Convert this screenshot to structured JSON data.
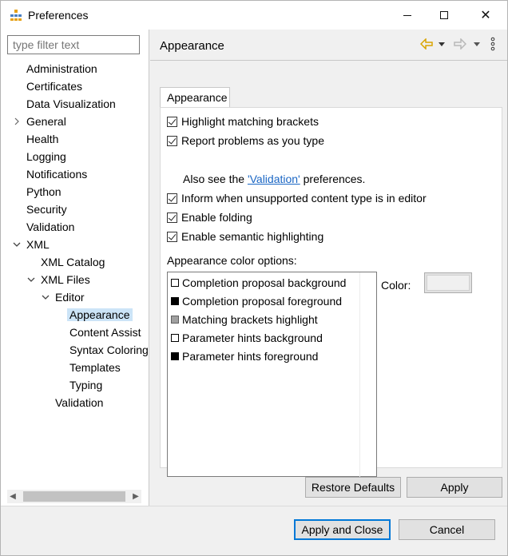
{
  "window": {
    "title": "Preferences",
    "minimize_icon": "minimize-icon",
    "maximize_icon": "maximize-icon",
    "close_glyph": "✕"
  },
  "filter": {
    "placeholder": "type filter text"
  },
  "tree": [
    {
      "label": "Administration",
      "indent": 0,
      "arrow": ""
    },
    {
      "label": "Certificates",
      "indent": 0,
      "arrow": ""
    },
    {
      "label": "Data Visualization",
      "indent": 0,
      "arrow": ""
    },
    {
      "label": "General",
      "indent": 0,
      "arrow": "›"
    },
    {
      "label": "Health",
      "indent": 0,
      "arrow": ""
    },
    {
      "label": "Logging",
      "indent": 0,
      "arrow": ""
    },
    {
      "label": "Notifications",
      "indent": 0,
      "arrow": ""
    },
    {
      "label": "Python",
      "indent": 0,
      "arrow": ""
    },
    {
      "label": "Security",
      "indent": 0,
      "arrow": ""
    },
    {
      "label": "Validation",
      "indent": 0,
      "arrow": ""
    },
    {
      "label": "XML",
      "indent": 0,
      "arrow": "⌄"
    },
    {
      "label": "XML Catalog",
      "indent": 1,
      "arrow": ""
    },
    {
      "label": "XML Files",
      "indent": 1,
      "arrow": "⌄"
    },
    {
      "label": "Editor",
      "indent": 2,
      "arrow": "⌄"
    },
    {
      "label": "Appearance",
      "indent": 3,
      "arrow": "",
      "selected": true
    },
    {
      "label": "Content Assist",
      "indent": 3,
      "arrow": ""
    },
    {
      "label": "Syntax Coloring",
      "indent": 3,
      "arrow": ""
    },
    {
      "label": "Templates",
      "indent": 3,
      "arrow": ""
    },
    {
      "label": "Typing",
      "indent": 3,
      "arrow": ""
    },
    {
      "label": "Validation",
      "indent": 2,
      "arrow": ""
    }
  ],
  "page": {
    "title": "Appearance",
    "tab": "Appearance"
  },
  "checkboxes": [
    {
      "label": "Highlight matching brackets",
      "checked": true
    },
    {
      "label": "Report problems as you type",
      "checked": true
    },
    {
      "label": "Inform when unsupported content type is in editor",
      "checked": true
    },
    {
      "label": "Enable folding",
      "checked": true
    },
    {
      "label": "Enable semantic highlighting",
      "checked": true
    }
  ],
  "see_also": {
    "prefix": "Also see the ",
    "link": "'Validation'",
    "suffix": " preferences."
  },
  "color_options": {
    "label": "Appearance color options:",
    "items": [
      {
        "label": "Completion proposal background",
        "swatch": "#ffffff"
      },
      {
        "label": "Completion proposal foreground",
        "swatch": "#000000"
      },
      {
        "label": "Matching brackets highlight",
        "swatch": "#a0a0a0"
      },
      {
        "label": "Parameter hints background",
        "swatch": "#ffffff"
      },
      {
        "label": "Parameter hints foreground",
        "swatch": "#000000"
      }
    ],
    "color_label": "Color:"
  },
  "buttons": {
    "restore_defaults": "Restore Defaults",
    "apply": "Apply",
    "apply_and_close": "Apply and Close",
    "cancel": "Cancel"
  },
  "colors": {
    "accent": "#0078d7",
    "selection": "#cce4f7",
    "link": "#1a66c4",
    "back_arrow": "#d9a400"
  }
}
